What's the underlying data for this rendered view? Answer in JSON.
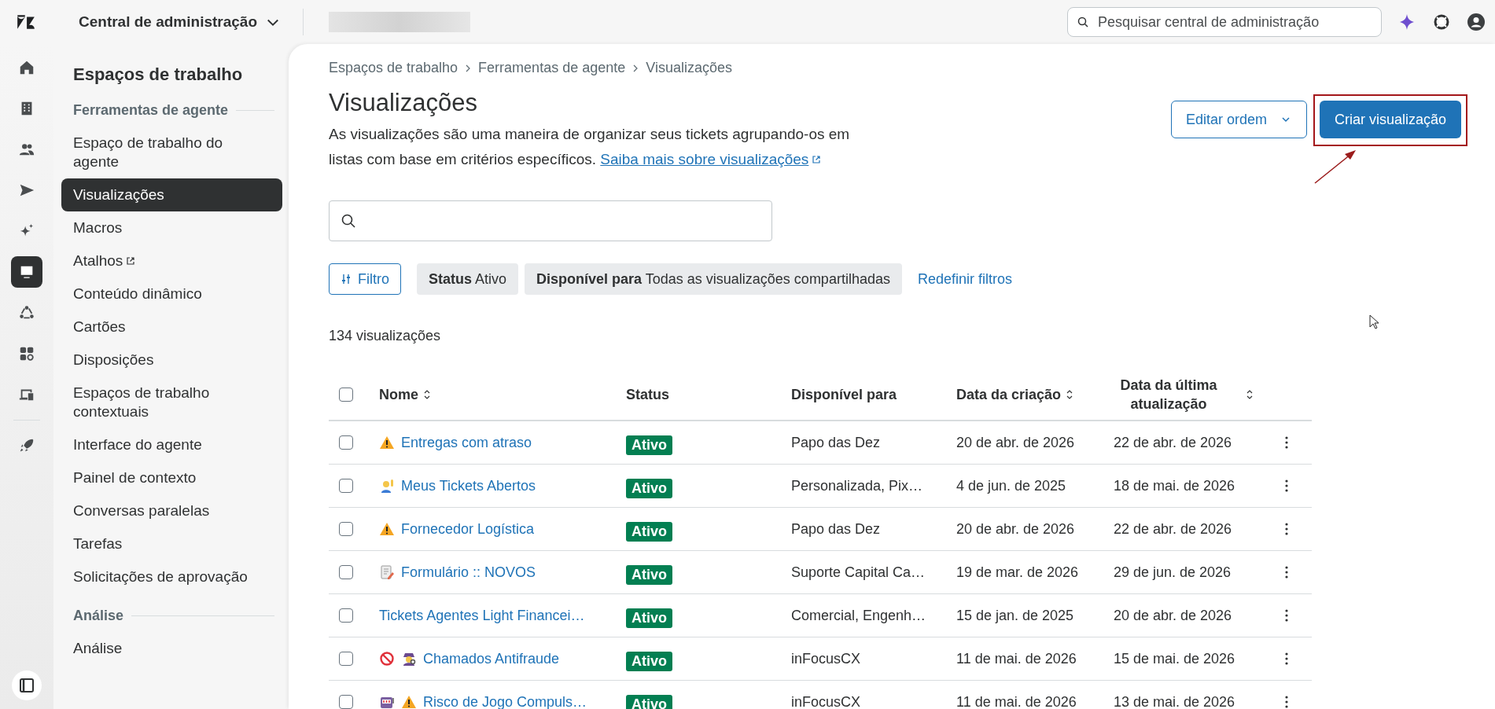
{
  "topbar": {
    "product": "Central de administração",
    "search": {
      "placeholder": "Pesquisar central de administração"
    }
  },
  "rail": {
    "items": [
      {
        "kind": "home",
        "selected": false
      },
      {
        "kind": "building",
        "selected": false
      },
      {
        "kind": "people",
        "selected": false
      },
      {
        "kind": "send",
        "selected": false
      },
      {
        "kind": "sparkle",
        "selected": false
      },
      {
        "kind": "workspace",
        "selected": true
      },
      {
        "kind": "objects",
        "selected": false
      },
      {
        "kind": "apps",
        "selected": false
      },
      {
        "kind": "devices",
        "selected": false
      },
      {
        "kind": "rocket",
        "selected": false
      }
    ]
  },
  "sidebar": {
    "title": "Espaços de trabalho",
    "sections": [
      {
        "heading": "Ferramentas de agente",
        "items": [
          {
            "label": "Espaço de trabalho do agente",
            "selected": false,
            "external": false
          },
          {
            "label": "Visualizações",
            "selected": true,
            "external": false
          },
          {
            "label": "Macros",
            "selected": false,
            "external": false
          },
          {
            "label": "Atalhos",
            "selected": false,
            "external": true
          },
          {
            "label": "Conteúdo dinâmico",
            "selected": false,
            "external": false
          },
          {
            "label": "Cartões",
            "selected": false,
            "external": false
          },
          {
            "label": "Disposições",
            "selected": false,
            "external": false
          },
          {
            "label": "Espaços de trabalho contextuais",
            "selected": false,
            "external": false
          },
          {
            "label": "Interface do agente",
            "selected": false,
            "external": false
          },
          {
            "label": "Painel de contexto",
            "selected": false,
            "external": false
          },
          {
            "label": "Conversas paralelas",
            "selected": false,
            "external": false
          },
          {
            "label": "Tarefas",
            "selected": false,
            "external": false
          },
          {
            "label": "Solicitações de aprovação",
            "selected": false,
            "external": false
          }
        ]
      },
      {
        "heading": "Análise",
        "items": [
          {
            "label": "Análise",
            "selected": false,
            "external": false
          }
        ]
      }
    ]
  },
  "breadcrumb": [
    "Espaços de trabalho",
    "Ferramentas de agente",
    "Visualizações"
  ],
  "title": "Visualizações",
  "description": {
    "text": "As visualizações são uma maneira de organizar seus tickets agrupando-os em listas com base em critérios específicos.",
    "link": "Saiba mais sobre visualizações"
  },
  "buttons": {
    "edit_order": "Editar ordem",
    "create": {
      "label": "Criar visualização",
      "highlighted": true
    }
  },
  "filter_button": "Filtro",
  "filters": [
    "**Status** Ativo",
    "**Disponível para** Todas as visualizações compartilhadas"
  ],
  "reset_filters": "Redefinir filtros",
  "count": "134 visualizações",
  "table": {
    "select_all": {
      "checked": false
    },
    "columns": [
      {
        "label": "Nome",
        "sortable": true
      },
      {
        "label": "Status",
        "sortable": false
      },
      {
        "label": "Disponível para",
        "sortable": false
      },
      {
        "label": "Data da criação",
        "sortable": true
      },
      {
        "label": "Data da última atualização",
        "sortable": true
      }
    ],
    "rows": [
      {
        "checked": false,
        "icons": [
          {
            "kind": "warning"
          }
        ],
        "name": "Entregas com atraso",
        "status": "Ativo",
        "available": "Papo das Dez",
        "created": "20 de abr. de 2026",
        "updated": "22 de abr. de 2026"
      },
      {
        "checked": false,
        "icons": [
          {
            "kind": "raised-hand"
          }
        ],
        "name": "Meus Tickets Abertos",
        "status": "Ativo",
        "available": "Personalizada, Pix…",
        "created": "4 de jun. de 2025",
        "updated": "18 de mai. de 2026"
      },
      {
        "checked": false,
        "icons": [
          {
            "kind": "warning"
          }
        ],
        "name": "Fornecedor Logística",
        "status": "Ativo",
        "available": "Papo das Dez",
        "created": "20 de abr. de 2026",
        "updated": "22 de abr. de 2026"
      },
      {
        "checked": false,
        "icons": [
          {
            "kind": "memo"
          }
        ],
        "name": "Formulário :: NOVOS",
        "status": "Ativo",
        "available": "Suporte Capital Ca…",
        "created": "19 de mar. de 2026",
        "updated": "29 de jun. de 2026"
      },
      {
        "checked": false,
        "icons": [],
        "name": "Tickets Agentes Light Financei…",
        "status": "Ativo",
        "available": "Comercial, Engenh…",
        "created": "15 de jan. de 2025",
        "updated": "20 de abr. de 2026"
      },
      {
        "checked": false,
        "icons": [
          {
            "kind": "prohibited"
          },
          {
            "kind": "detective"
          }
        ],
        "name": "Chamados Antifraude",
        "status": "Ativo",
        "available": "inFocusCX",
        "created": "11 de mai. de 2026",
        "updated": "15 de mai. de 2026"
      },
      {
        "checked": false,
        "icons": [
          {
            "kind": "slot-machine"
          },
          {
            "kind": "warning"
          }
        ],
        "name": "Risco de Jogo Compuls…",
        "status": "Ativo",
        "available": "inFocusCX",
        "created": "11 de mai. de 2026",
        "updated": "13 de mai. de 2026"
      }
    ]
  }
}
